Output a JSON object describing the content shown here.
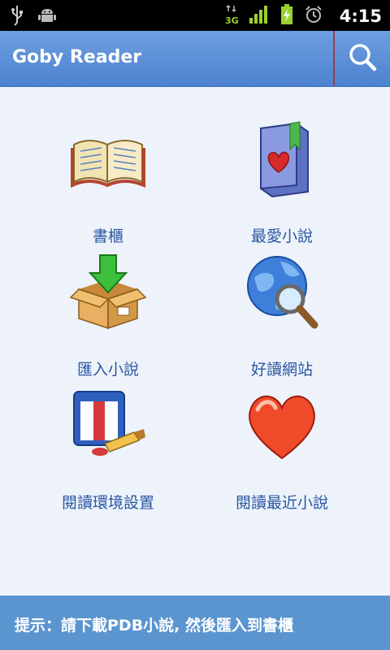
{
  "status_bar": {
    "time": "4:15",
    "network": "3G",
    "icons": [
      "usb-icon",
      "android-icon",
      "3g-data-icon",
      "signal-bars-icon",
      "battery-charging-icon",
      "alarm-icon"
    ]
  },
  "app_bar": {
    "title": "Goby Reader",
    "search_icon": "search-icon"
  },
  "menu": [
    {
      "label": "書櫃",
      "icon": "open-book-icon"
    },
    {
      "label": "最愛小說",
      "icon": "favorite-book-icon"
    },
    {
      "label": "匯入小說",
      "icon": "import-box-icon"
    },
    {
      "label": "好讀網站",
      "icon": "globe-search-icon"
    },
    {
      "label": "閱讀環境設置",
      "icon": "paint-settings-icon"
    },
    {
      "label": "閱讀最近小說",
      "icon": "heart-icon"
    }
  ],
  "hint": {
    "text": "提示：請下載PDB小說, 然後匯入到書櫃"
  },
  "colors": {
    "app_bar": "#5a8ed8",
    "hint_bar": "#5b95cf",
    "background": "#eef3fb",
    "label": "#2a56a1"
  }
}
